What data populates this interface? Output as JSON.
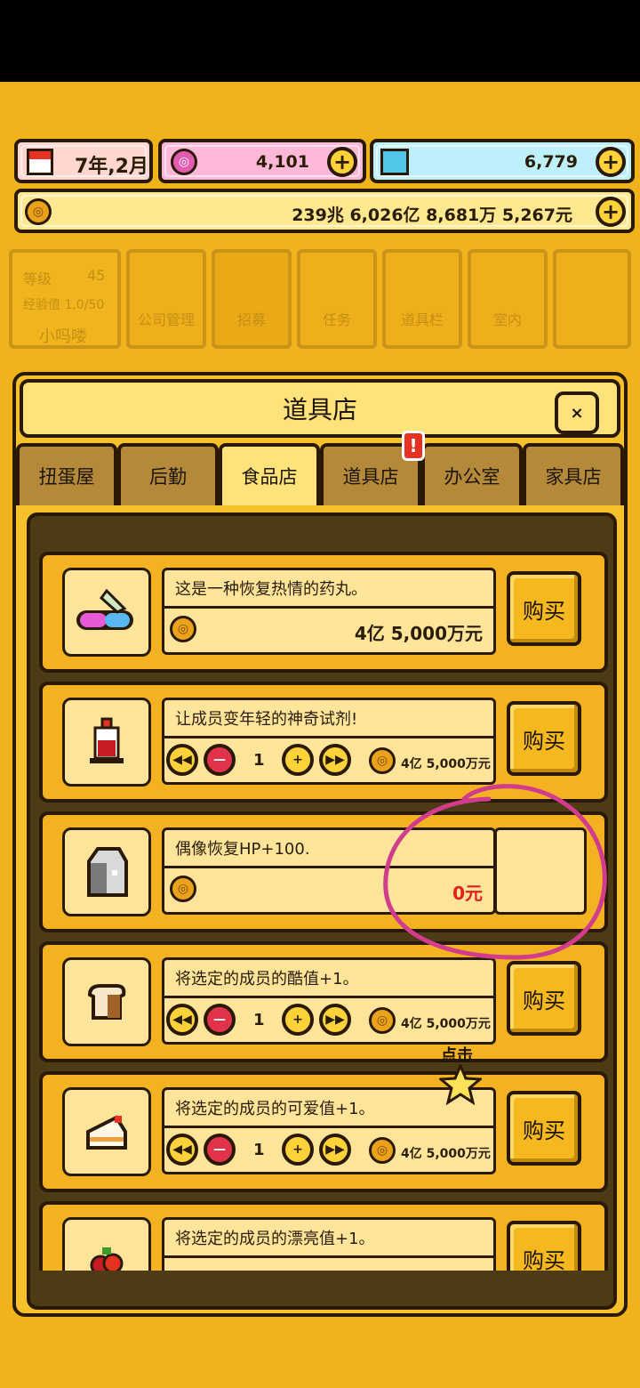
{
  "resources": {
    "date": "7年,2月",
    "pink_currency": "4,101",
    "gems": "6,779",
    "money": "239兆 6,026亿 8,681万 5,267元",
    "plus": "+"
  },
  "background_nav": {
    "level_label": "等级",
    "level_value": "45",
    "exp_label": "经验值 1.0/50",
    "player_name": "小吗喽",
    "items": [
      "公司管理",
      "招募",
      "任务",
      "道具栏",
      "室内"
    ]
  },
  "shop": {
    "title": "道具店",
    "close": "×",
    "tabs": [
      "扭蛋屋",
      "后勤",
      "食品店",
      "道具店",
      "办公室",
      "家具店"
    ],
    "active_tab": "食品店",
    "alert": "!",
    "buy_label": "购买",
    "items": [
      {
        "desc": "这是一种恢复热情的药丸。",
        "price": "4亿 5,000万元",
        "icon": "pill-icon"
      },
      {
        "desc": "让成员变年轻的神奇试剂!",
        "qty": "1",
        "price": "4亿 5,000万元",
        "icon": "potion-icon"
      },
      {
        "desc": "偶像恢复HP+100.",
        "price": "0元",
        "icon": "milk-carton-icon"
      },
      {
        "desc": "将选定的成员的酷值+1。",
        "qty": "1",
        "price": "4亿 5,000万元",
        "icon": "bread-icon"
      },
      {
        "desc": "将选定的成员的可爱值+1。",
        "qty": "1",
        "price": "4亿 5,000万元",
        "icon": "cake-icon"
      },
      {
        "desc": "将选定的成员的漂亮值+1。",
        "icon": "fruit-icon"
      }
    ]
  },
  "tutorial": {
    "tap_hint": "点击"
  },
  "colors": {
    "accent": "#f6b81f",
    "annotation": "#d23c8c",
    "price_zero": "#e02020"
  }
}
